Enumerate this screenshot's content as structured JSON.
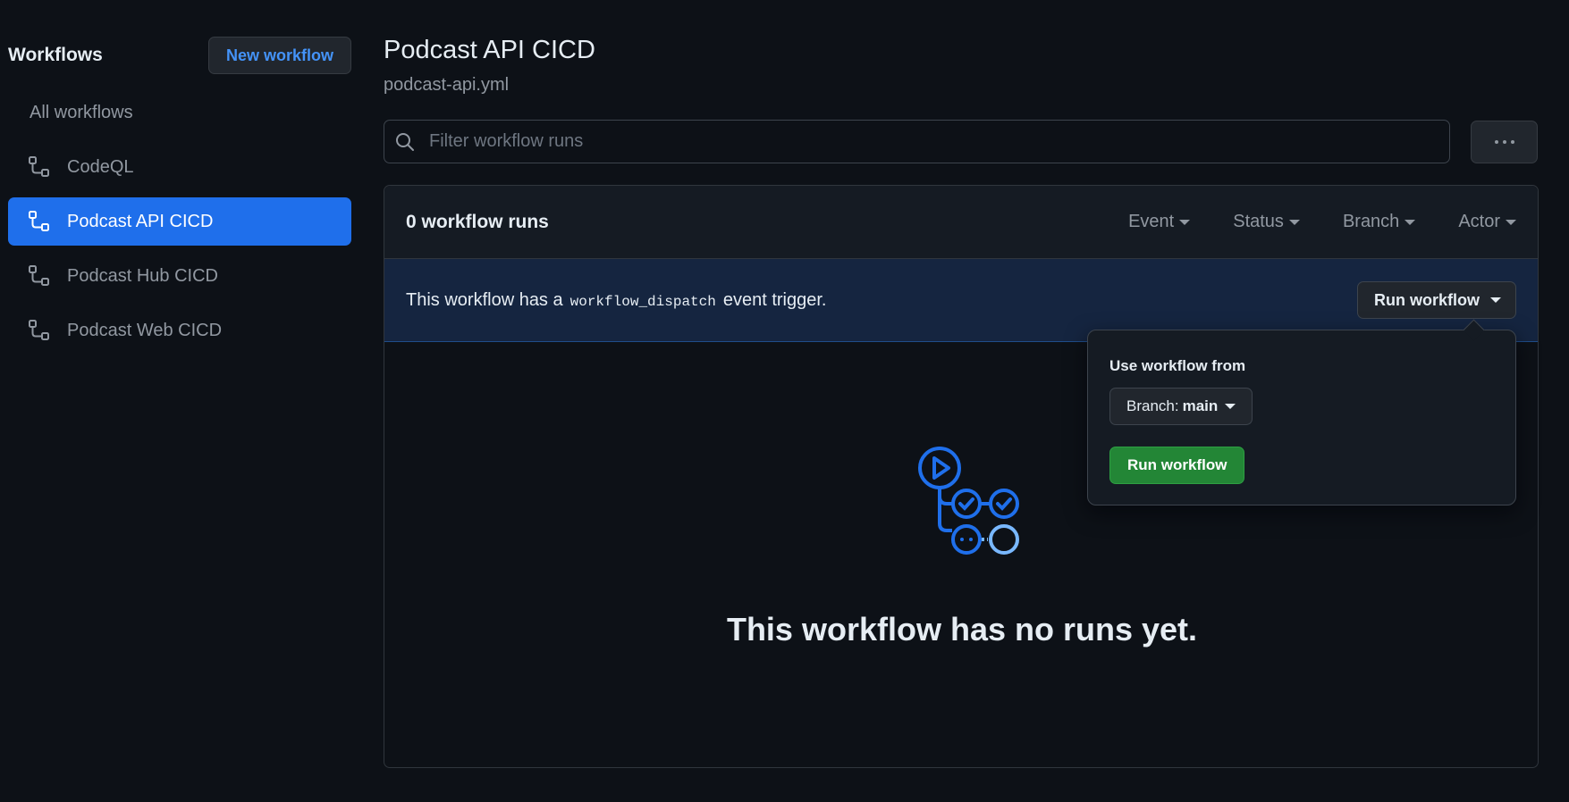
{
  "sidebar": {
    "title": "Workflows",
    "new_workflow_label": "New workflow",
    "items": [
      {
        "label": "All workflows"
      },
      {
        "label": "CodeQL"
      },
      {
        "label": "Podcast API CICD"
      },
      {
        "label": "Podcast Hub CICD"
      },
      {
        "label": "Podcast Web CICD"
      }
    ],
    "active_index": 2
  },
  "main": {
    "title": "Podcast API CICD",
    "file": "podcast-api.yml",
    "filter_placeholder": "Filter workflow runs",
    "runs_count": "0 workflow runs",
    "filters": [
      "Event",
      "Status",
      "Branch",
      "Actor"
    ],
    "banner": {
      "prefix": "This workflow has a",
      "code": "workflow_dispatch",
      "suffix": "event trigger.",
      "run_label": "Run workflow"
    },
    "empty_text": "This workflow has no runs yet."
  },
  "popover": {
    "label": "Use workflow from",
    "branch_prefix": "Branch:",
    "branch_value": "main",
    "run_label": "Run workflow"
  },
  "colors": {
    "accent": "#1f6feb",
    "link": "#4493f8",
    "primary_button": "#238636",
    "background": "#0d1117"
  }
}
